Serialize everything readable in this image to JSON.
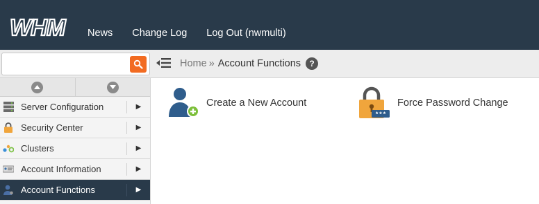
{
  "header": {
    "logo_text": "WHM",
    "nav": [
      {
        "label": "News"
      },
      {
        "label": "Change Log"
      },
      {
        "label": "Log Out (nwmulti)"
      }
    ]
  },
  "search": {
    "value": "",
    "placeholder": ""
  },
  "breadcrumb": {
    "home": "Home",
    "separator": "»",
    "current": "Account Functions",
    "help_glyph": "?"
  },
  "sidebar": {
    "items": [
      {
        "label": "Server Configuration",
        "icon": "server-icon",
        "active": false
      },
      {
        "label": "Security Center",
        "icon": "lock-icon",
        "active": false
      },
      {
        "label": "Clusters",
        "icon": "cluster-icon",
        "active": false
      },
      {
        "label": "Account Information",
        "icon": "account-info-icon",
        "active": false
      },
      {
        "label": "Account Functions",
        "icon": "user-icon",
        "active": true
      }
    ],
    "arrow_glyph": "▶"
  },
  "main": {
    "features": [
      {
        "label": "Create a New Account",
        "icon": "add-user-icon"
      },
      {
        "label": "Force Password Change",
        "icon": "padlock-password-icon"
      }
    ]
  },
  "colors": {
    "topbar": "#293a4a",
    "search_button": "#f26b21",
    "active_nav": "#293a4a",
    "padlock": "#f0a53c"
  }
}
